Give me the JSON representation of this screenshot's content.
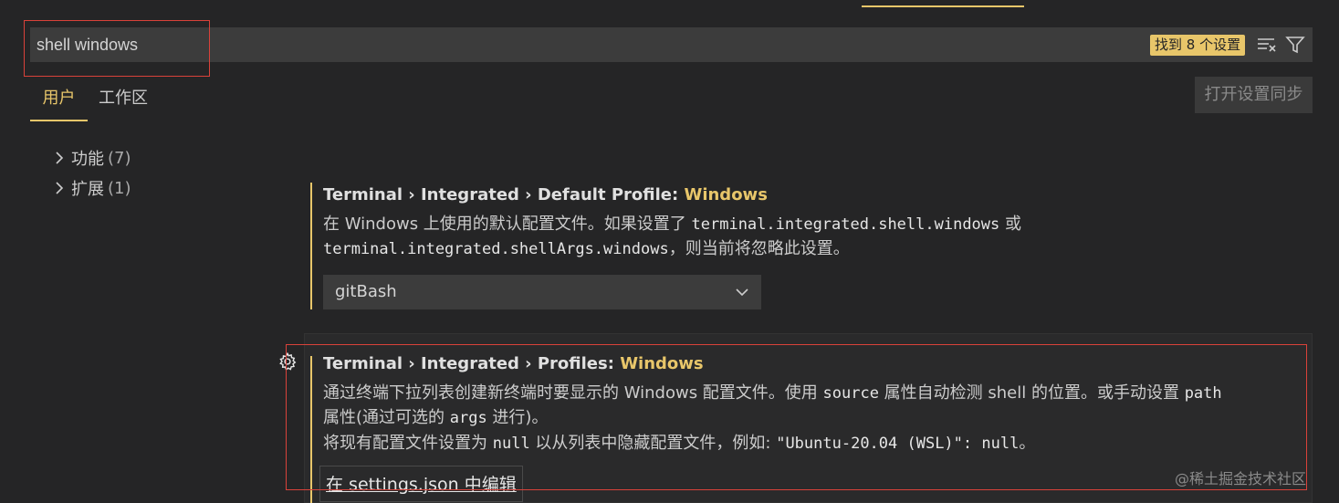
{
  "search": {
    "value": "shell windows",
    "result_badge": "找到 8 个设置"
  },
  "tabs": [
    {
      "label": "用户",
      "active": true
    },
    {
      "label": "工作区",
      "active": false
    }
  ],
  "sync_button": "打开设置同步",
  "tree": [
    {
      "label": "功能",
      "count": "(7)"
    },
    {
      "label": "扩展",
      "count": "(1)"
    }
  ],
  "settings": [
    {
      "path": "Terminal › Integrated › Default Profile: ",
      "highlight": "Windows",
      "desc_line1": {
        "pre": "在 Windows 上使用的默认配置文件。如果设置了 ",
        "code1": "terminal.integrated.shell.windows",
        "post": " 或"
      },
      "desc_line2": {
        "code": "terminal.integrated.shellArgs.windows",
        "post": "，则当前将忽略此设置。"
      },
      "dropdown_value": "gitBash"
    },
    {
      "path": "Terminal › Integrated › Profiles: ",
      "highlight": "Windows",
      "desc_line1": {
        "pre": "通过终端下拉列表创建新终端时要显示的 Windows 配置文件。使用 ",
        "code1": "source",
        "mid": " 属性自动检测 shell 的位置。或手动设置 ",
        "code2": "path"
      },
      "desc_line2": {
        "pre": "属性(通过可选的 ",
        "code": "args",
        "post": " 进行)。"
      },
      "desc_line3": {
        "pre": "将现有配置文件设置为 ",
        "code1": "null",
        "mid": " 以从列表中隐藏配置文件，例如: ",
        "code2": "\"Ubuntu-20.04 (WSL)\": null",
        "post": "。"
      },
      "edit_link": "在 settings.json 中编辑"
    }
  ],
  "watermark": "@稀土掘金技术社区",
  "colors": {
    "accent": "#e8c66a",
    "background": "#252526",
    "annotation": "#d9423a"
  }
}
